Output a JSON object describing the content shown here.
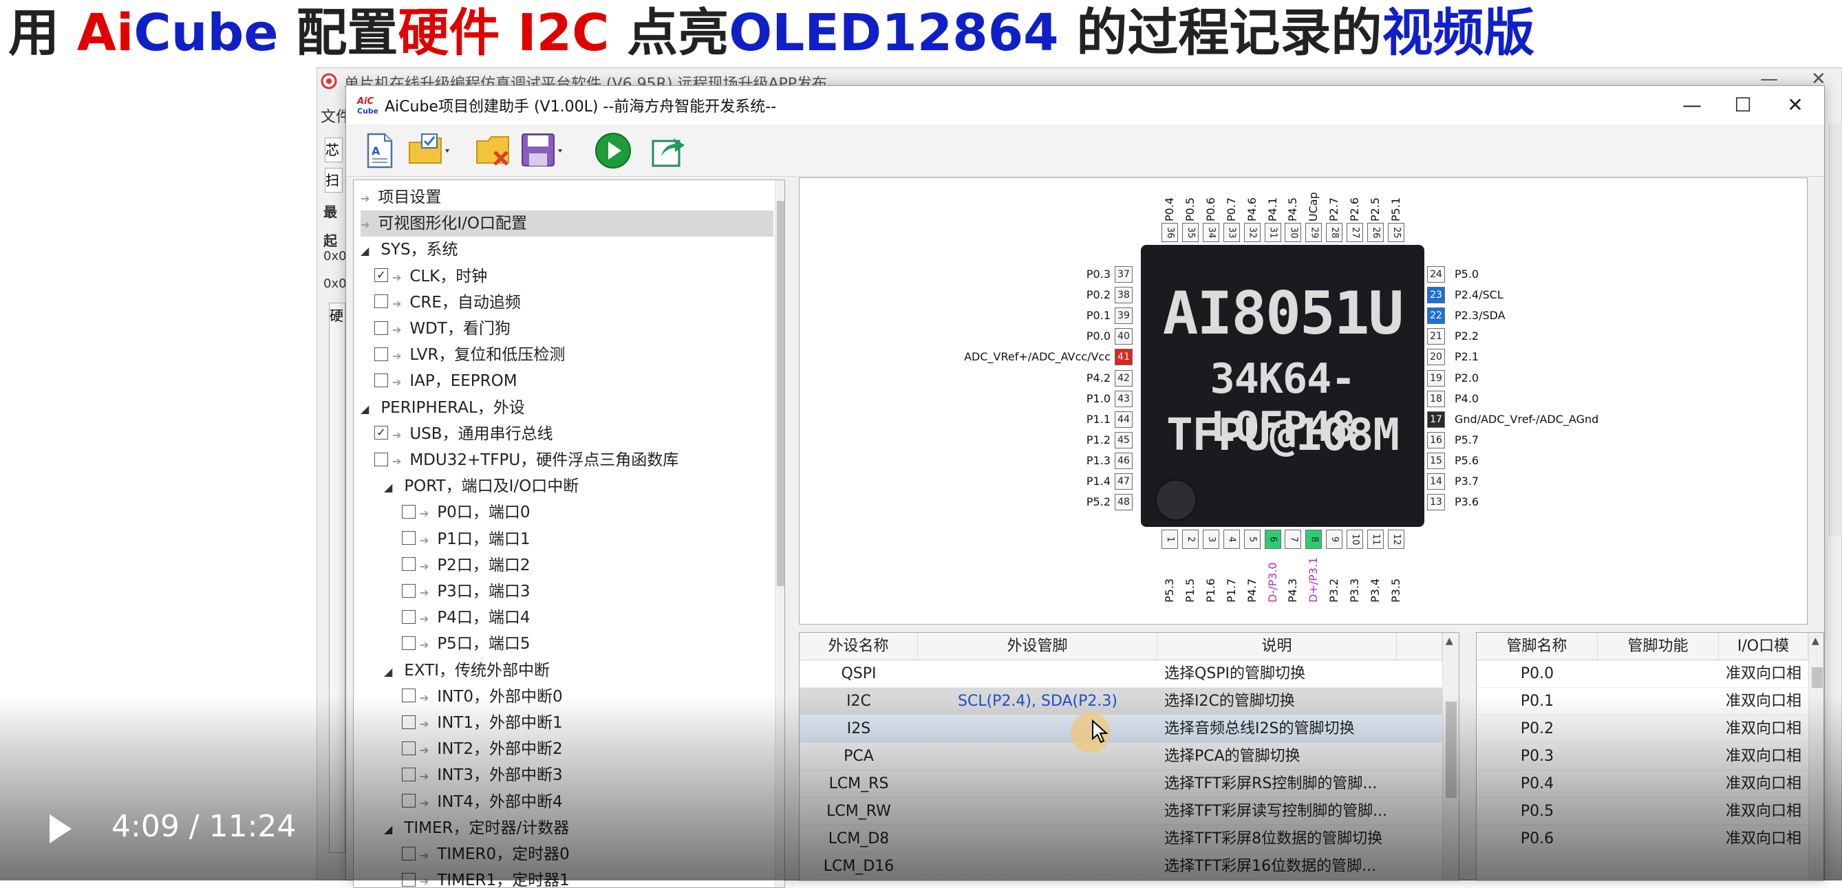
{
  "headline": {
    "p1": "用 ",
    "p2": "Ai",
    "p3": "Cube",
    "p4": " 配置",
    "p5": "硬件 I2C",
    "p6": " 点亮",
    "p7": "OLED12864",
    "p8": " 的过程记录的",
    "p9": "视频版",
    "colors": {
      "black": "#222222",
      "red": "#e00000",
      "blue": "#1020c8"
    }
  },
  "background_app": {
    "title": "单片机在线升级编程仿真调试平台软件 (V6.95R) 远程现场升级APP发布",
    "menu_file": "文件",
    "fragments": [
      "芯",
      "扫",
      "最",
      "起",
      "0x0",
      "0x0",
      "硬"
    ]
  },
  "window": {
    "title": "AiCube项目创建助手 (V1.00L) --前海方舟智能开发系统--",
    "icon_text": "AiCube",
    "controls": {
      "minimize": "—",
      "maximize": "☐",
      "close": "✕"
    }
  },
  "toolbar": {
    "icons": [
      "new-file-icon",
      "open-folder-icon",
      "delete-folder-icon",
      "save-icon",
      "run-icon",
      "export-icon"
    ]
  },
  "tree": {
    "items": [
      {
        "label": "项目设置",
        "checked": false
      },
      {
        "label": "可视图形化I/O口配置",
        "checked": false
      },
      {
        "label": "SYS，系统",
        "checked": false
      },
      {
        "label": "CLK，时钟",
        "checked": true
      },
      {
        "label": "CRE，自动追频",
        "checked": false
      },
      {
        "label": "WDT，看门狗",
        "checked": false
      },
      {
        "label": "LVR，复位和低压检测",
        "checked": false
      },
      {
        "label": "IAP，EEPROM",
        "checked": false
      },
      {
        "label": "PERIPHERAL，外设",
        "checked": false
      },
      {
        "label": "USB，通用串行总线",
        "checked": true
      },
      {
        "label": "MDU32+TFPU，硬件浮点三角函数库",
        "checked": false
      },
      {
        "label": "PORT，端口及I/O口中断",
        "checked": false
      },
      {
        "label": "P0口，端口0",
        "checked": false
      },
      {
        "label": "P1口，端口1",
        "checked": false
      },
      {
        "label": "P2口，端口2",
        "checked": false
      },
      {
        "label": "P3口，端口3",
        "checked": false
      },
      {
        "label": "P4口，端口4",
        "checked": false
      },
      {
        "label": "P5口，端口5",
        "checked": false
      },
      {
        "label": "EXTI，传统外部中断",
        "checked": false
      },
      {
        "label": "INT0，外部中断0",
        "checked": false
      },
      {
        "label": "INT1，外部中断1",
        "checked": false
      },
      {
        "label": "INT2，外部中断2",
        "checked": false
      },
      {
        "label": "INT3，外部中断3",
        "checked": false
      },
      {
        "label": "INT4，外部中断4",
        "checked": false
      },
      {
        "label": "TIMER，定时器/计数器",
        "checked": false
      },
      {
        "label": "TIMER0，定时器0",
        "checked": false
      },
      {
        "label": "TIMER1，定时器1",
        "checked": false
      }
    ]
  },
  "chip": {
    "line1": "AI8051U",
    "line2": "34K64-LQFP48",
    "line3": "TFPU@108M",
    "top_pins": [
      {
        "num": "36",
        "name": "P0.4"
      },
      {
        "num": "35",
        "name": "P0.5"
      },
      {
        "num": "34",
        "name": "P0.6"
      },
      {
        "num": "33",
        "name": "P0.7"
      },
      {
        "num": "32",
        "name": "P4.6"
      },
      {
        "num": "31",
        "name": "P4.1"
      },
      {
        "num": "30",
        "name": "P4.5"
      },
      {
        "num": "29",
        "name": "UCap"
      },
      {
        "num": "28",
        "name": "P2.7"
      },
      {
        "num": "27",
        "name": "P2.6"
      },
      {
        "num": "26",
        "name": "P2.5"
      },
      {
        "num": "25",
        "name": "P5.1"
      }
    ],
    "left_pins": [
      {
        "num": "37",
        "name": "P0.3",
        "state": "normal"
      },
      {
        "num": "38",
        "name": "P0.2",
        "state": "normal"
      },
      {
        "num": "39",
        "name": "P0.1",
        "state": "normal"
      },
      {
        "num": "40",
        "name": "P0.0",
        "state": "normal"
      },
      {
        "num": "41",
        "name": "ADC_VRef+/ADC_AVcc/Vcc",
        "state": "power"
      },
      {
        "num": "42",
        "name": "P4.2",
        "state": "normal"
      },
      {
        "num": "43",
        "name": "P1.0",
        "state": "normal"
      },
      {
        "num": "44",
        "name": "P1.1",
        "state": "normal"
      },
      {
        "num": "45",
        "name": "P1.2",
        "state": "normal"
      },
      {
        "num": "46",
        "name": "P1.3",
        "state": "normal"
      },
      {
        "num": "47",
        "name": "P1.4",
        "state": "normal"
      },
      {
        "num": "48",
        "name": "P5.2",
        "state": "normal"
      }
    ],
    "right_pins": [
      {
        "num": "24",
        "name": "P5.0",
        "state": "normal"
      },
      {
        "num": "23",
        "name": "P2.4/SCL",
        "state": "selected"
      },
      {
        "num": "22",
        "name": "P2.3/SDA",
        "state": "selected"
      },
      {
        "num": "21",
        "name": "P2.2",
        "state": "normal"
      },
      {
        "num": "20",
        "name": "P2.1",
        "state": "normal"
      },
      {
        "num": "19",
        "name": "P2.0",
        "state": "normal"
      },
      {
        "num": "18",
        "name": "P4.0",
        "state": "normal"
      },
      {
        "num": "17",
        "name": "Gnd/ADC_Vref-/ADC_AGnd",
        "state": "ground"
      },
      {
        "num": "16",
        "name": "P5.7",
        "state": "normal"
      },
      {
        "num": "15",
        "name": "P5.6",
        "state": "normal"
      },
      {
        "num": "14",
        "name": "P3.7",
        "state": "normal"
      },
      {
        "num": "13",
        "name": "P3.6",
        "state": "normal"
      }
    ],
    "bottom_pins": [
      {
        "num": "1",
        "name": "P5.3",
        "state": "normal"
      },
      {
        "num": "2",
        "name": "P1.5",
        "state": "normal"
      },
      {
        "num": "3",
        "name": "P1.6",
        "state": "normal"
      },
      {
        "num": "4",
        "name": "P1.7",
        "state": "normal"
      },
      {
        "num": "5",
        "name": "P4.7",
        "state": "normal"
      },
      {
        "num": "6",
        "name": "D-/P3.0",
        "state": "usb"
      },
      {
        "num": "7",
        "name": "P4.3",
        "state": "normal"
      },
      {
        "num": "8",
        "name": "D+/P3.1",
        "state": "usb"
      },
      {
        "num": "9",
        "name": "P3.2",
        "state": "normal"
      },
      {
        "num": "10",
        "name": "P3.3",
        "state": "normal"
      },
      {
        "num": "11",
        "name": "P3.4",
        "state": "normal"
      },
      {
        "num": "12",
        "name": "P3.5",
        "state": "normal"
      }
    ],
    "colors": {
      "selected": "#1e6fd9",
      "power": "#d8281e",
      "ground": "#2b2b2b",
      "usb": "#2ecc71",
      "usb_label": "#b030c8"
    }
  },
  "periph_table": {
    "headers": [
      "外设名称",
      "外设管脚",
      "说明"
    ],
    "rows": [
      {
        "name": "QSPI",
        "pins": "",
        "desc": "选择QSPI的管脚切换",
        "state": "normal"
      },
      {
        "name": "I2C",
        "pins": "SCL(P2.4), SDA(P2.3)",
        "desc": "选择I2C的管脚切换",
        "state": "selected"
      },
      {
        "name": "I2S",
        "pins": "",
        "desc": "选择音频总线I2S的管脚切换",
        "state": "hover"
      },
      {
        "name": "PCA",
        "pins": "",
        "desc": "选择PCA的管脚切换",
        "state": "normal"
      },
      {
        "name": "LCM_RS",
        "pins": "",
        "desc": "选择TFT彩屏RS控制脚的管脚...",
        "state": "normal"
      },
      {
        "name": "LCM_RW",
        "pins": "",
        "desc": "选择TFT彩屏读写控制脚的管脚...",
        "state": "normal"
      },
      {
        "name": "LCM_D8",
        "pins": "",
        "desc": "选择TFT彩屏8位数据的管脚切换",
        "state": "normal"
      },
      {
        "name": "LCM_D16",
        "pins": "",
        "desc": "选择TFT彩屏16位数据的管脚...",
        "state": "normal"
      }
    ]
  },
  "pin_table": {
    "headers": [
      "管脚名称",
      "管脚功能",
      "I/O口模"
    ],
    "rows": [
      {
        "name": "P0.0",
        "func": "",
        "mode": "准双向口相"
      },
      {
        "name": "P0.1",
        "func": "",
        "mode": "准双向口相"
      },
      {
        "name": "P0.2",
        "func": "",
        "mode": "准双向口相"
      },
      {
        "name": "P0.3",
        "func": "",
        "mode": "准双向口相"
      },
      {
        "name": "P0.4",
        "func": "",
        "mode": "准双向口相"
      },
      {
        "name": "P0.5",
        "func": "",
        "mode": "准双向口相"
      },
      {
        "name": "P0.6",
        "func": "",
        "mode": "准双向口相"
      }
    ]
  },
  "video": {
    "time": "4:09 / 11:24",
    "play_icon": "play-icon"
  }
}
